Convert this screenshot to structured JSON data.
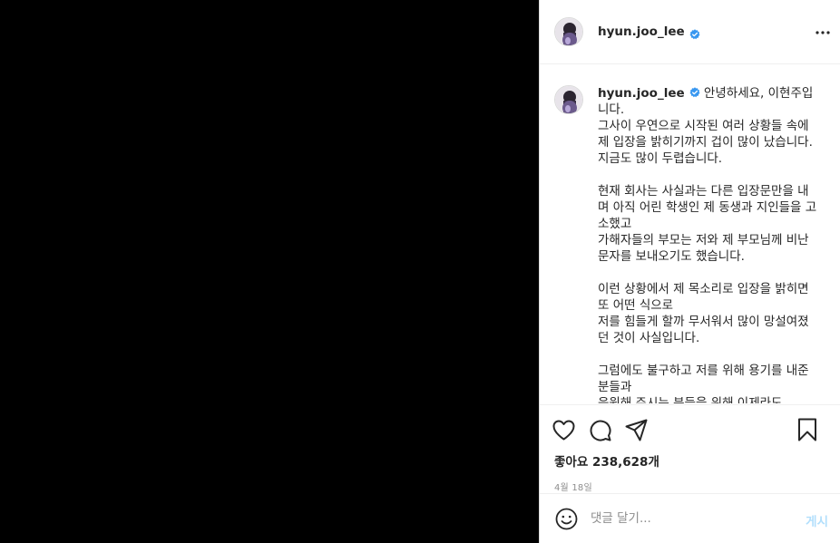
{
  "colors": {
    "media_background": "#000000",
    "verified": "#3897f0",
    "post_button_disabled": "#b2dffc",
    "secondary_text": "#8e8e8e"
  },
  "header": {
    "username": "hyun.joo_lee",
    "verified": true,
    "more_icon": "more-horizontal-icon"
  },
  "caption": {
    "username": "hyun.joo_lee",
    "text": " 안녕하세요, 이현주입니다.\n그사이 우연으로 시작된 여러 상황들 속에 제 입장을 밝히기까지 겁이 많이 났습니다. 지금도 많이 두렵습니다.\n\n현재 회사는 사실과는 다른 입장문만을 내며 아직 어린 학생인 제 동생과 지인들을 고소했고\n가해자들의 부모는 저와 제 부모님께 비난 문자를 보내오기도 했습니다.\n\n이런 상황에서 제 목소리로 입장을 밝히면 또 어떤 식으로\n저를 힘들게 할까 무서워서 많이 망설여졌던 것이 사실입니다.\n\n그럼에도 불구하고 저를 위해 용기를 내준 분들과\n응원해 주시는 분들을 위해 이제라도"
  },
  "actions": {
    "icons": [
      "heart-icon",
      "comment-icon",
      "share-icon",
      "bookmark-icon"
    ],
    "likes": "좋아요 238,628개",
    "date": "4월 18일"
  },
  "comment": {
    "placeholder": "댓글 달기...",
    "post_label": "게시"
  }
}
